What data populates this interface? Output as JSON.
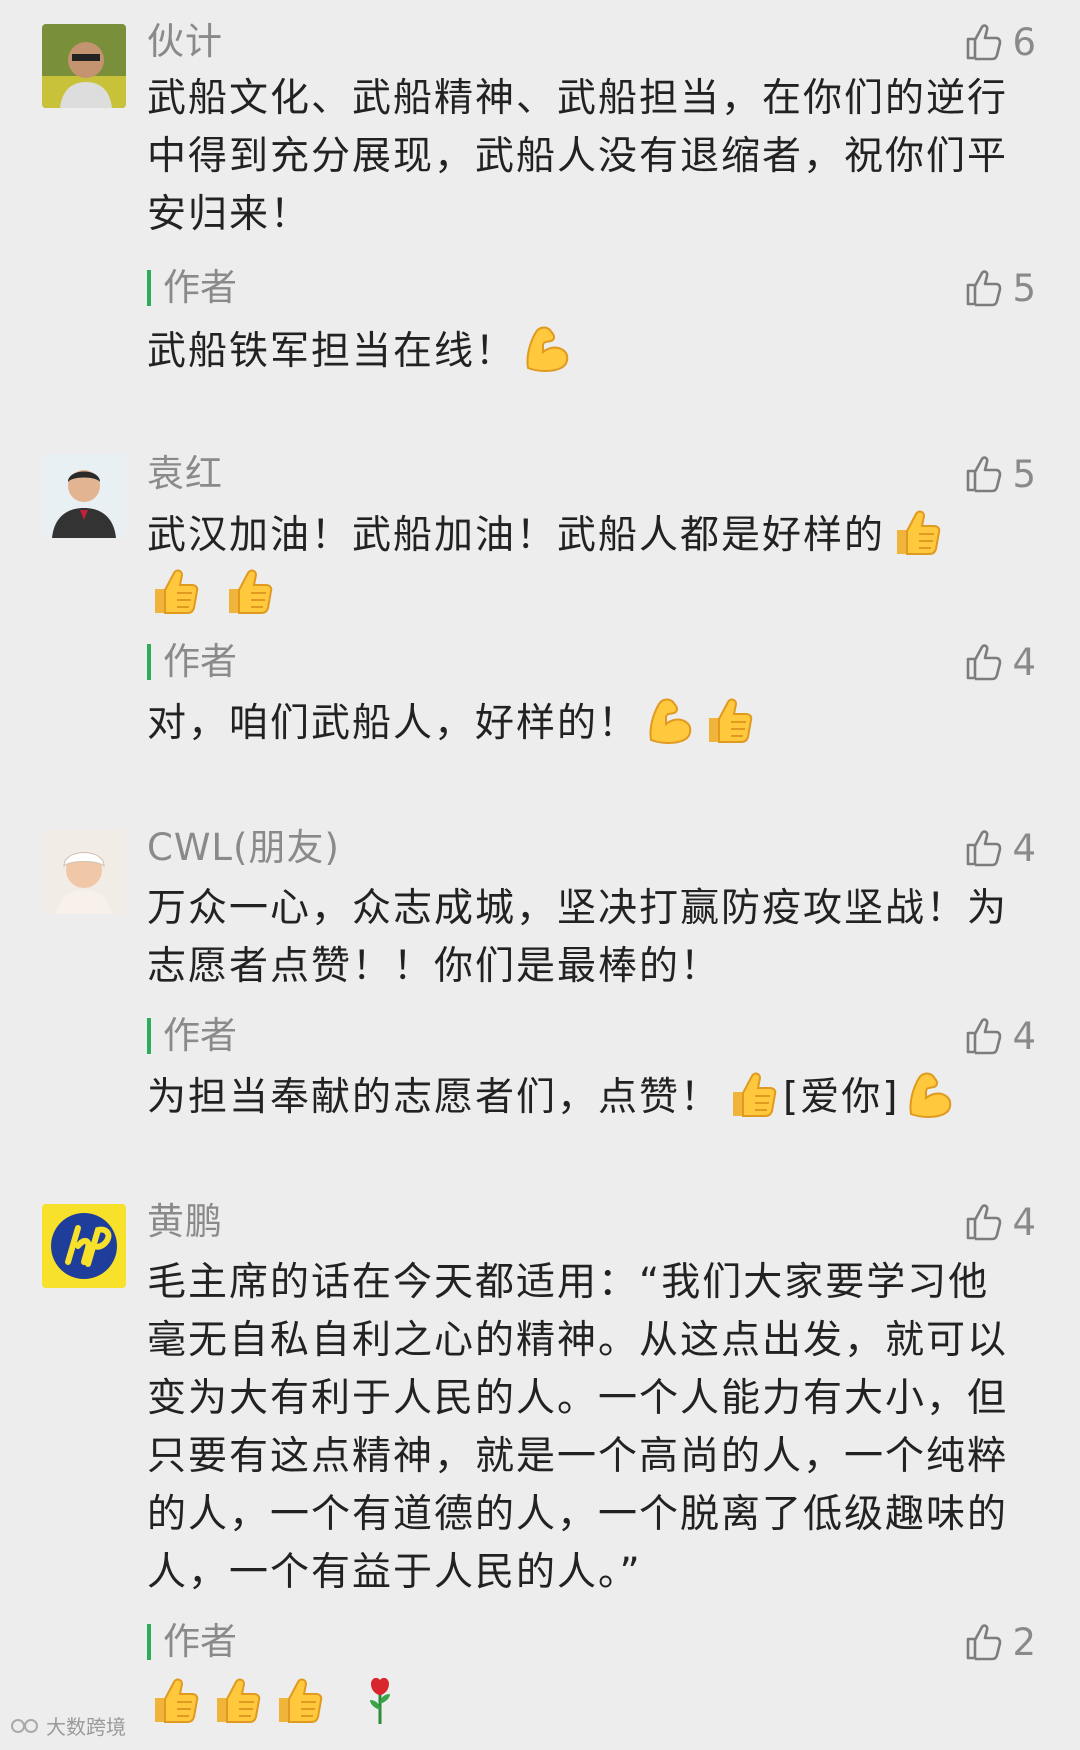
{
  "comments": [
    {
      "name": "伙计",
      "likes": "6",
      "text": "武船文化、武船精神、武船担当，在你们的逆行中得到充分展现，武船人没有退缩者，祝你们平安归来！",
      "reply": {
        "label": "作者",
        "likes": "5",
        "text": "武船铁军担当在线！",
        "emojis": [
          "flexed-biceps-emoji"
        ]
      }
    },
    {
      "name": "袁红",
      "likes": "5",
      "text": "武汉加油！武船加油！武船人都是好样的",
      "emojis": [
        "thumbs-up-emoji",
        "thumbs-up-emoji",
        "thumbs-up-emoji"
      ],
      "reply": {
        "label": "作者",
        "likes": "4",
        "text": "对，咱们武船人，好样的！",
        "emojis": [
          "flexed-biceps-emoji",
          "thumbs-up-emoji"
        ]
      }
    },
    {
      "name": "CWL(朋友)",
      "likes": "4",
      "text": "万众一心，众志成城，坚决打赢防疫攻坚战！为志愿者点赞！！你们是最棒的！",
      "reply": {
        "label": "作者",
        "likes": "4",
        "text": "为担当奉献的志愿者们，点赞！",
        "tail": "[爱你]",
        "emojis": [
          "thumbs-up-emoji",
          "flexed-biceps-emoji"
        ]
      }
    },
    {
      "name": "黄鹏",
      "likes": "4",
      "text": "毛主席的话在今天都适用：“我们大家要学习他毫无自私自利之心的精神。从这点出发，就可以变为大有利于人民的人。一个人能力有大小，但只要有这点精神，就是一个高尚的人，一个纯粹的人，一个有道德的人，一个脱离了低级趣味的人，一个有益于人民的人。”",
      "reply": {
        "label": "作者",
        "likes": "2",
        "emojis": [
          "thumbs-up-emoji",
          "thumbs-up-emoji",
          "thumbs-up-emoji",
          "rose-emoji"
        ]
      }
    }
  ],
  "watermark": "大数跨境",
  "colors": {
    "author_bar": "#2cad5a",
    "meta_text": "#8a8a8a",
    "background": "#ededed"
  }
}
